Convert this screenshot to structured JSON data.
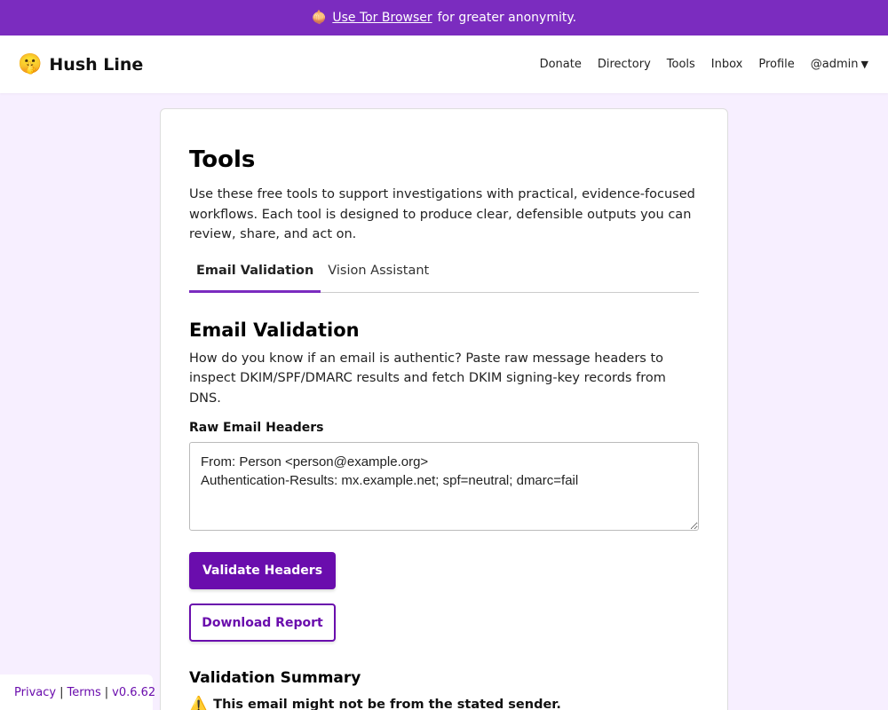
{
  "banner": {
    "icon": "onion-icon",
    "link": "Use Tor Browser",
    "text": "for greater anonymity."
  },
  "header": {
    "brand_emoji": "🤫",
    "brand_name": "Hush Line",
    "nav": [
      "Donate",
      "Directory",
      "Tools",
      "Inbox",
      "Profile"
    ],
    "user_menu": "@admin"
  },
  "main": {
    "title": "Tools",
    "intro": "Use these free tools to support investigations with practical, evidence-focused workflows. Each tool is designed to produce clear, defensible outputs you can review, share, and act on.",
    "tabs": [
      {
        "label": "Email Validation",
        "active": true
      },
      {
        "label": "Vision Assistant",
        "active": false
      }
    ],
    "section_title": "Email Validation",
    "section_desc": "How do you know if an email is authentic? Paste raw message headers to inspect DKIM/SPF/DMARC results and fetch DKIM signing-key records from DNS.",
    "field_label": "Raw Email Headers",
    "headers_value": "From: Person <person@example.org>\nAuthentication-Results: mx.example.net; spf=neutral; dmarc=fail",
    "validate_button": "Validate Headers",
    "download_button": "Download Report",
    "summary_title": "Validation Summary",
    "summary_icon": "⚠️",
    "summary_text": "This email might not be from the stated sender."
  },
  "footer": {
    "privacy": "Privacy",
    "terms": "Terms",
    "version": "v0.6.62",
    "separator": "|"
  },
  "colors": {
    "banner": "#7b2cbf",
    "primary": "#6a0dad",
    "page_bg": "#f7efff"
  }
}
